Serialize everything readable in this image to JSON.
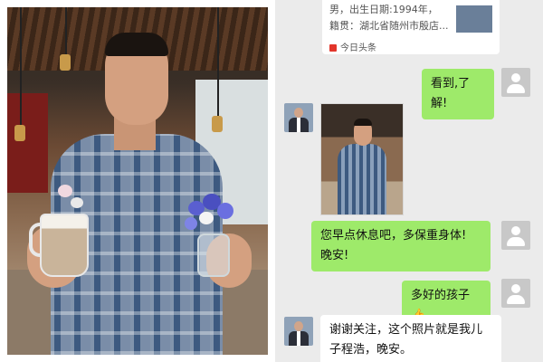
{
  "chat": {
    "shared_card": {
      "line1": "男，出生日期:1994年，",
      "line2": "籍贯：湖北省随州市殷店...",
      "source": "今日头条"
    },
    "messages": [
      {
        "sender": "user",
        "text": "看到,了解!"
      },
      {
        "sender": "contact",
        "type": "image"
      },
      {
        "sender": "user",
        "text": "您早点休息吧，多保重身体! 晚安!"
      },
      {
        "sender": "user",
        "text": "多好的孩子👍"
      },
      {
        "sender": "contact",
        "text": "谢谢关注，这个照片就是我儿子程浩，晚安。"
      }
    ]
  },
  "colors": {
    "chat_background": "#ebebeb",
    "sent_bubble": "#9eea6a",
    "received_bubble": "#ffffff"
  }
}
